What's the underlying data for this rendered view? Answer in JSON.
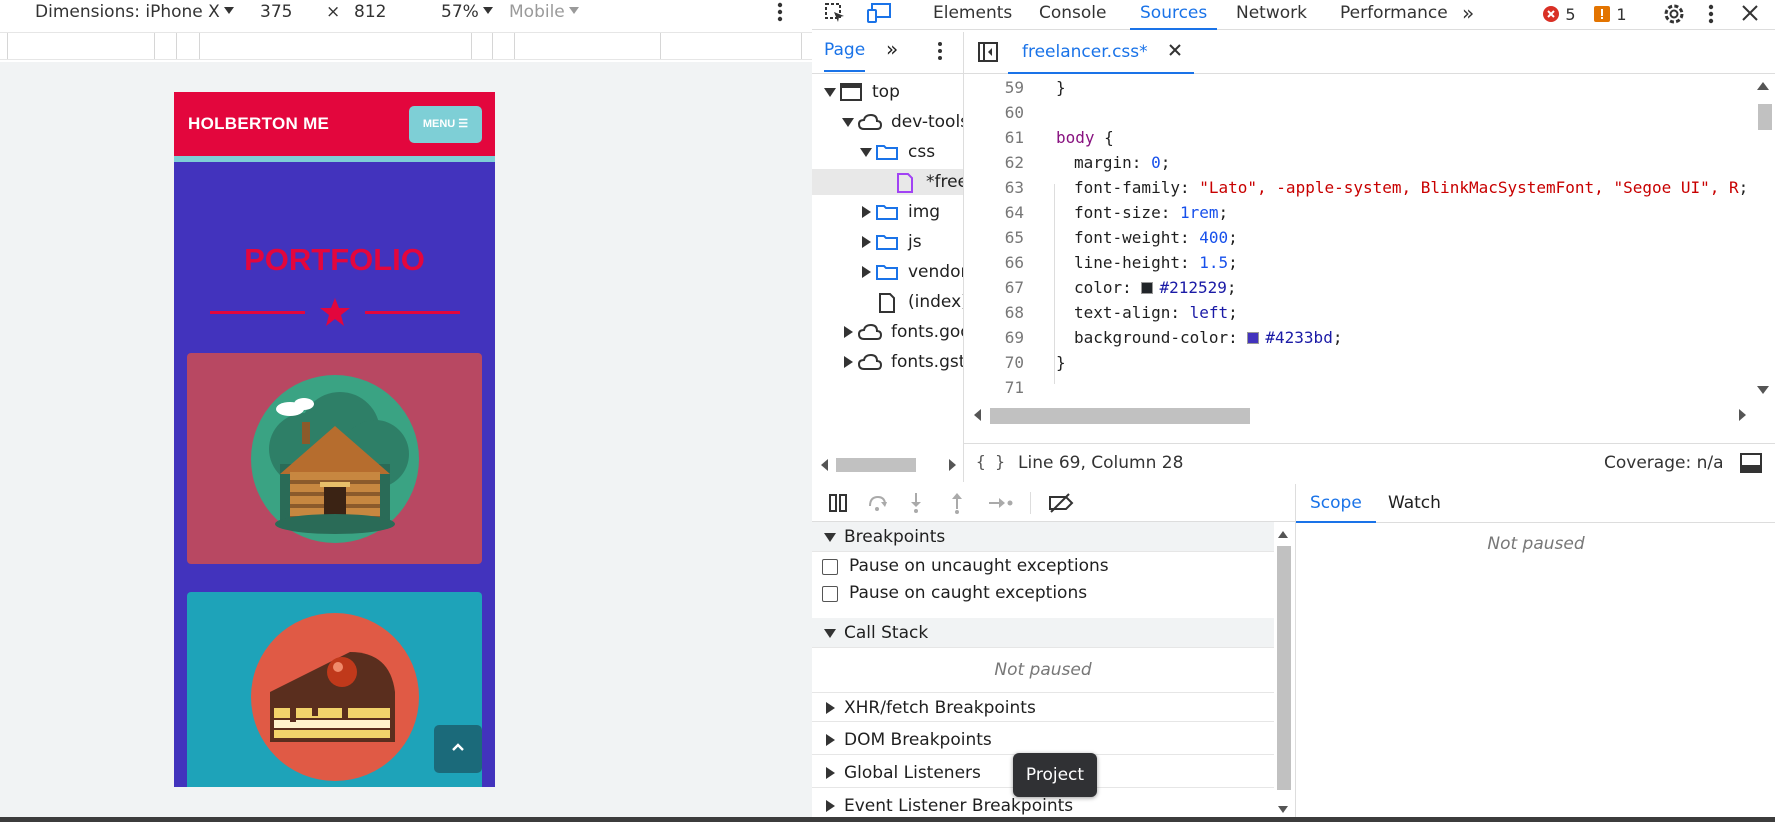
{
  "device_toolbar": {
    "dimensions_label": "Dimensions: iPhone X",
    "width": "375",
    "times": "×",
    "height": "812",
    "zoom": "57%",
    "throttle": "Mobile"
  },
  "phone_page": {
    "brand": "HOLBERTON ME",
    "menu_label": "MENU",
    "section_title": "PORTFOLIO",
    "colors": {
      "nav": "#e3063d",
      "stripe": "#7ecfd6",
      "background": "#4233bd",
      "card1": "#b84862",
      "card2": "#1ea3b9"
    }
  },
  "devtools": {
    "tabs": [
      "Elements",
      "Console",
      "Sources",
      "Network",
      "Performance"
    ],
    "active_tab": "Sources",
    "errors": "5",
    "warnings": "1",
    "navigator": {
      "tab": "Page",
      "tree": [
        {
          "label": "top",
          "icon": "frame-icon"
        },
        {
          "label": "dev-tools",
          "icon": "cloud-icon"
        },
        {
          "label": "css",
          "icon": "folder-icon"
        },
        {
          "label": "*freelancer.css",
          "icon": "file-css-icon"
        },
        {
          "label": "img",
          "icon": "folder-icon"
        },
        {
          "label": "js",
          "icon": "folder-icon"
        },
        {
          "label": "vendor",
          "icon": "folder-icon"
        },
        {
          "label": "(index)",
          "icon": "file-icon"
        },
        {
          "label": "fonts.googleapis.com",
          "icon": "cloud-icon"
        },
        {
          "label": "fonts.gstatic.com",
          "icon": "cloud-icon"
        }
      ]
    },
    "editor": {
      "file_tab": "freelancer.css*",
      "lines": [
        {
          "n": "59",
          "text": "}"
        },
        {
          "n": "60",
          "text": ""
        },
        {
          "n": "61",
          "sel": "body",
          "brace": " {"
        },
        {
          "n": "62",
          "prop": "margin",
          "val": "0",
          "valtype": "num"
        },
        {
          "n": "63",
          "prop": "font-family",
          "val": "\"Lato\", -apple-system, BlinkMacSystemFont, \"Segoe UI\", R",
          "valtype": "mixed"
        },
        {
          "n": "64",
          "prop": "font-size",
          "val": "1rem",
          "valtype": "num"
        },
        {
          "n": "65",
          "prop": "font-weight",
          "val": "400",
          "valtype": "num"
        },
        {
          "n": "66",
          "prop": "line-height",
          "val": "1.5",
          "valtype": "num"
        },
        {
          "n": "67",
          "prop": "color",
          "val": "#212529",
          "valtype": "hex",
          "swatch": "#212529"
        },
        {
          "n": "68",
          "prop": "text-align",
          "val": "left",
          "valtype": "id"
        },
        {
          "n": "69",
          "prop": "background-color",
          "val": "#4233bd",
          "valtype": "hex",
          "swatch": "#4233bd"
        },
        {
          "n": "70",
          "text": "}"
        },
        {
          "n": "71",
          "text": ""
        }
      ],
      "status_position": "Line 69, Column 28",
      "coverage": "Coverage: n/a"
    },
    "debugger": {
      "breakpoints_title": "Breakpoints",
      "pause_uncaught": "Pause on uncaught exceptions",
      "pause_caught": "Pause on caught exceptions",
      "call_stack_title": "Call Stack",
      "not_paused": "Not paused",
      "sections": [
        "XHR/fetch Breakpoints",
        "DOM Breakpoints",
        "Global Listeners",
        "Event Listener Breakpoints"
      ]
    },
    "scope": {
      "tabs": [
        "Scope",
        "Watch"
      ],
      "active": "Scope",
      "not_paused": "Not paused"
    },
    "tooltip": "Project"
  }
}
